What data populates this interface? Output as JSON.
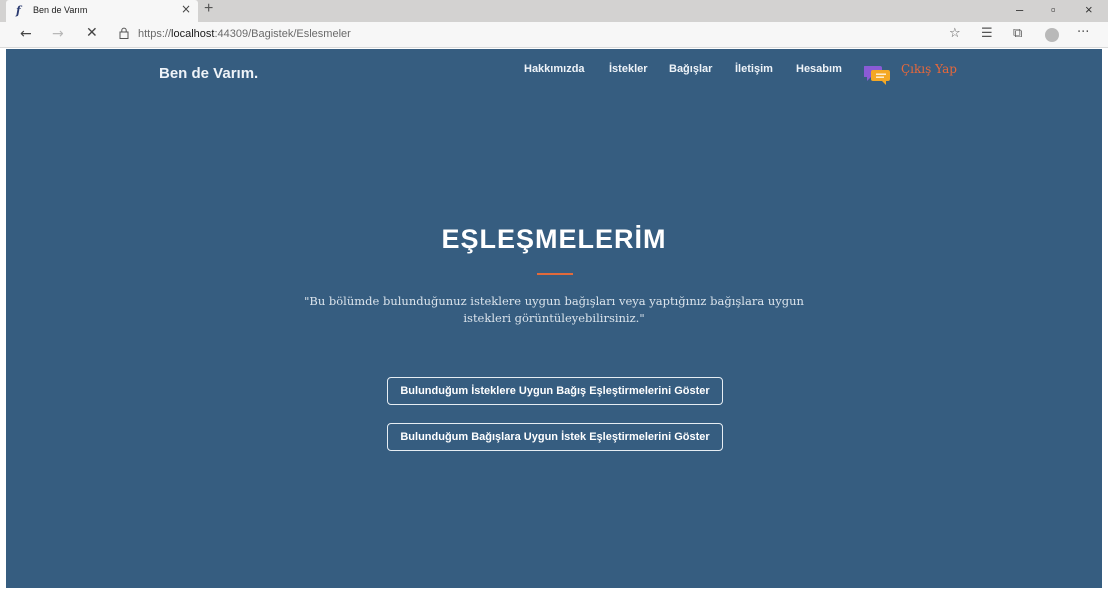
{
  "browser": {
    "tab_title": "Ben de Varım",
    "tab_favicon": "f",
    "url_prefix": "https://",
    "url_host": "localhost",
    "url_rest": ":44309/Bagistek/Eslesmeler",
    "icons": [
      "back-icon",
      "forward-icon",
      "stop-icon",
      "lock-icon",
      "star-icon",
      "favorites-icon",
      "collections-icon",
      "profile-icon",
      "more-icon",
      "minimize-icon",
      "maximize-icon",
      "close-icon",
      "new-tab-icon"
    ]
  },
  "site": {
    "brand": "Ben de Varım.",
    "nav": {
      "about": "Hakkımızda",
      "requests": "İstekler",
      "donations": "Bağışlar",
      "contact": "İletişim",
      "account": "Hesabım",
      "logout": "Çıkış Yap"
    },
    "colors": {
      "background": "#365d80",
      "accent": "#e26a3b",
      "logout": "#e8683a"
    }
  },
  "hero": {
    "title": "EŞLEŞMELERİM",
    "description": "\"Bu bölümde bulunduğunuz isteklere uygun bağışları veya yaptığınız bağışlara uygun istekleri görüntüleyebilirsiniz.\""
  },
  "buttons": {
    "requests_match": "Bulunduğum İsteklere Uygun Bağış Eşleştirmelerini Göster",
    "donations_match": "Bulunduğum Bağışlara Uygun İstek Eşleştirmelerini Göster"
  }
}
